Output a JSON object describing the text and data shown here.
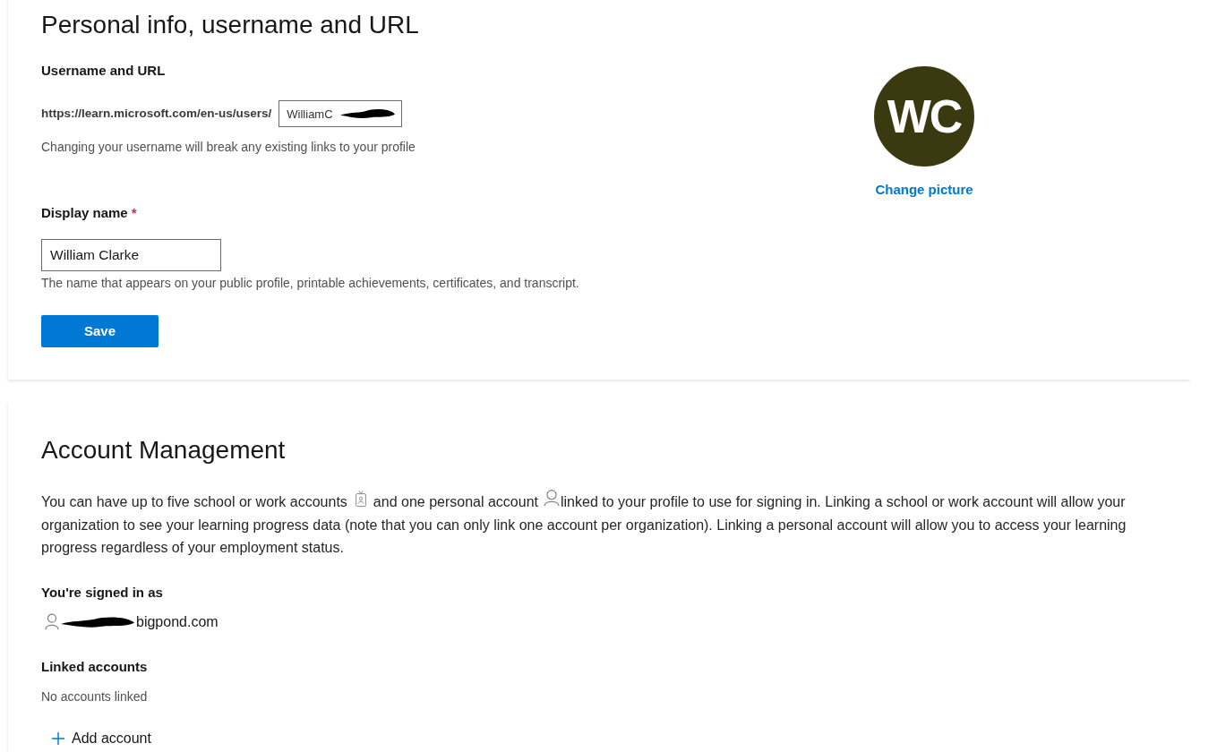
{
  "personal_info": {
    "title": "Personal info, username and URL",
    "username": {
      "heading": "Username and URL",
      "url_prefix": "https://learn.microsoft.com/en-us/users/",
      "value": "WilliamC",
      "redacted": true,
      "hint": "Changing your username will break any existing links to your profile"
    },
    "display_name": {
      "label": "Display name",
      "required_mark": "*",
      "value": "William Clarke",
      "hint": "The name that appears on your public profile, printable achievements, certificates, and transcript."
    },
    "save_button": "Save",
    "avatar": {
      "initials": "WC",
      "link": "Change picture"
    }
  },
  "account_management": {
    "title": "Account Management",
    "intro": [
      "You can have up to five school or work accounts",
      "and one personal account",
      "linked to your profile to use for signing in. Linking a school or work account will allow your organization to see your learning progress data (note that you can only link one account per organization). Linking a personal account will allow you to access your learning progress regardless of your employment status."
    ],
    "signed_in": {
      "heading": "You're signed in as",
      "email": "bigpond.com",
      "redacted": true
    },
    "linked_accounts": {
      "heading": "Linked accounts",
      "empty_text": "No accounts linked",
      "add_button": "Add account"
    }
  }
}
